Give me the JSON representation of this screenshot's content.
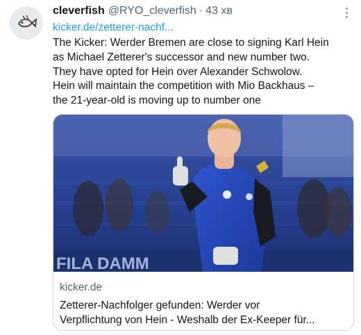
{
  "tweet": {
    "display_name": "cleverfish",
    "handle": "@RYO_cleverfish",
    "separator": "·",
    "time": "43 хв",
    "link": "kicker.de/zetterer-nachf...",
    "text_lines": [
      "The Kicker: Werder Bremen are close to signing Karl Hein",
      "as Michael Zetterer's successor and new number two.",
      "They have opted for Hein over Alexander Schwolow.",
      "Hein will maintain the competition with Mio Backhaus –",
      "the 21-year-old is moving up to number one"
    ]
  },
  "card": {
    "domain": "kicker.de",
    "title_lines": [
      "Zetterer-Nachfolger gefunden: Werder vor",
      "Verpflichtung von Hein - Weshalb der Ex-Keeper für..."
    ],
    "image_icon": "goalkeeper-photo"
  },
  "icons": {
    "avatar": "fish-avatar-icon",
    "more": "more-options-icon"
  },
  "colors": {
    "link": "#1d9bf0",
    "secondary_text": "#536471",
    "primary_text": "#0f1419",
    "border": "#cfd9de",
    "jersey": "#2346b8"
  }
}
